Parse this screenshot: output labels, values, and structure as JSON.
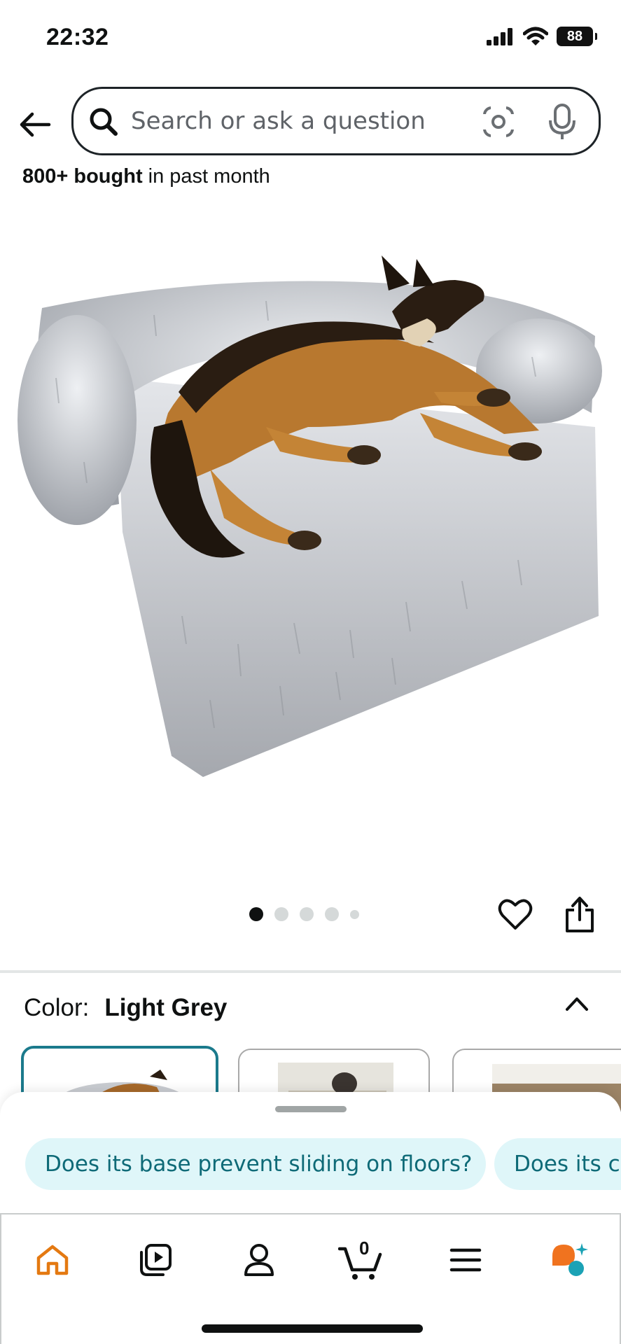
{
  "status": {
    "time": "22:32",
    "battery": "88"
  },
  "search": {
    "placeholder": "Search or ask a question"
  },
  "product": {
    "bought_count": "800+ bought",
    "bought_suffix": " in past month",
    "carousel_pages": 5,
    "carousel_active": 1
  },
  "color": {
    "label": "Color:",
    "value": "Light Grey"
  },
  "suggestions": [
    "Does its base prevent sliding on floors?",
    "Does its co"
  ],
  "nav": {
    "cart_count": "0"
  },
  "colors": {
    "accent": "#1b7a8c",
    "chip_bg": "#dff6f9",
    "chip_text": "#0e6a77",
    "home_orange": "#e47911"
  }
}
